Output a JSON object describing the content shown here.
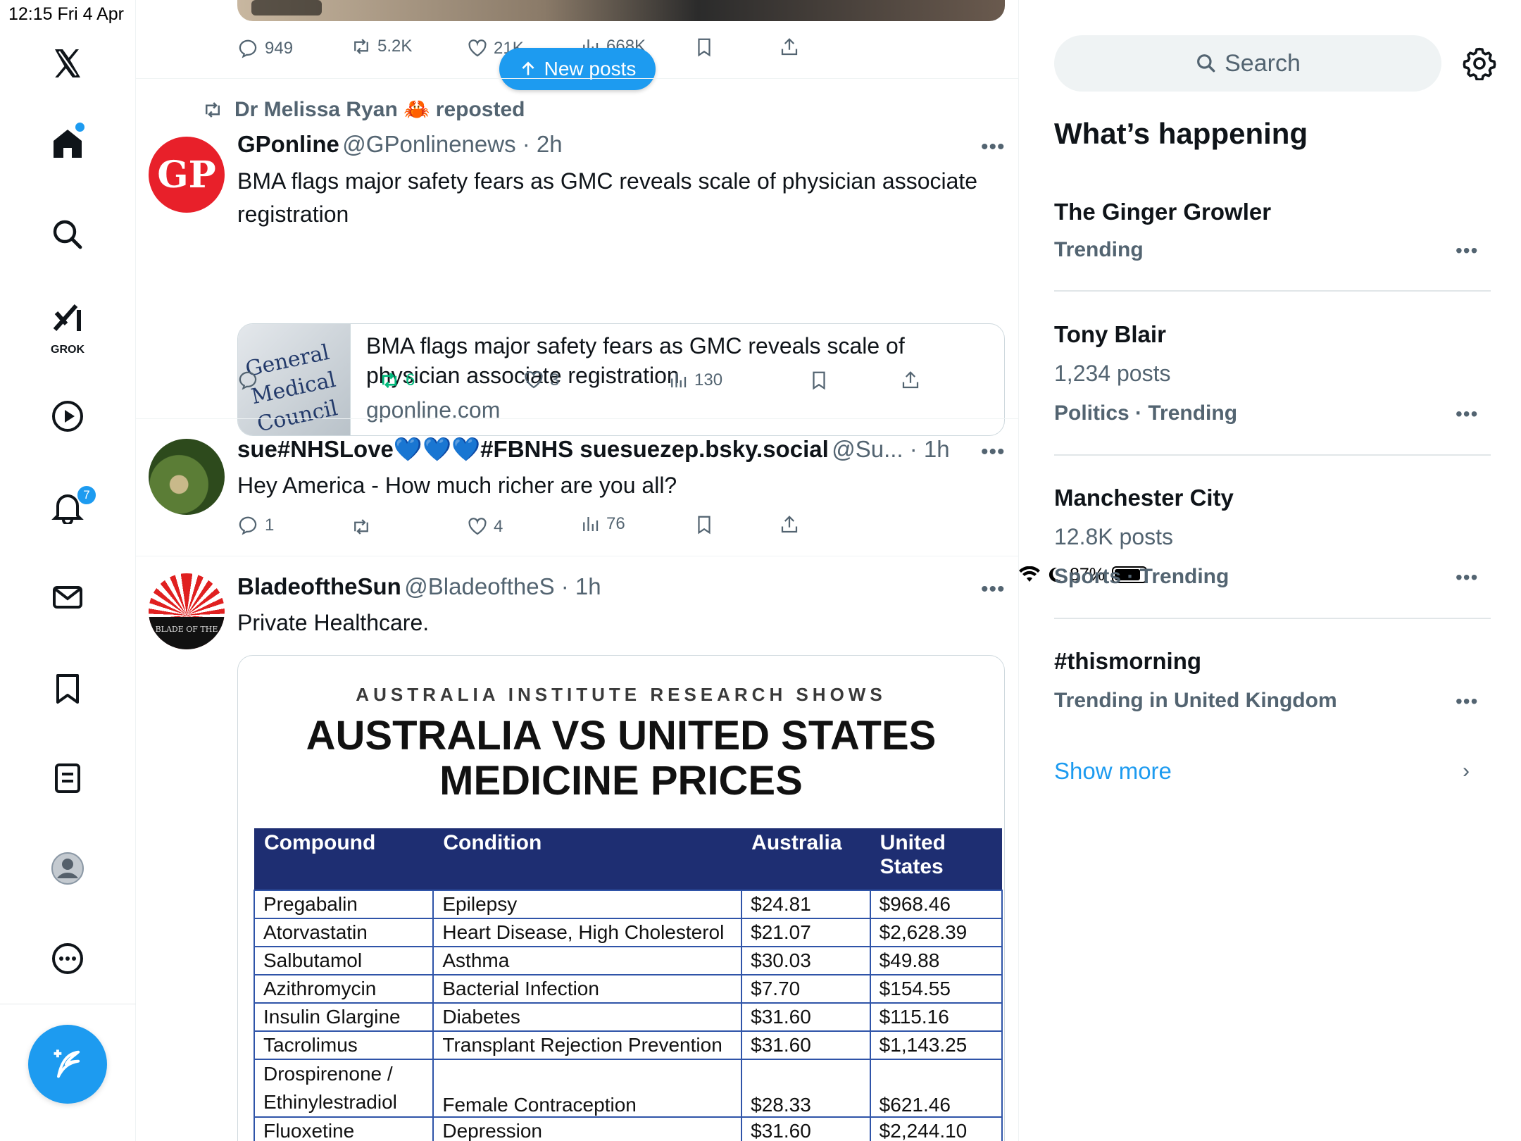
{
  "status_bar": {
    "time_date": "12:15   Fri 4 Apr",
    "battery": "87%",
    "battery_level": 0.87
  },
  "sidebar": {
    "grok_label": "GROK",
    "notifications_count": "7"
  },
  "new_posts": {
    "label": "New posts"
  },
  "previous_tweet": {
    "replies": "949",
    "reposts": "5.2K",
    "likes": "21K",
    "views": "668K"
  },
  "tweets": [
    {
      "repost_note": "Dr Melissa Ryan 🦀 reposted",
      "name": "GPonline",
      "handle": "@GPonlinenews · 2h",
      "avatar_text": "GP",
      "text": "BMA flags major safety fears as GMC reveals scale of physician associate registration",
      "link_card": {
        "thumb_text": "General Medical Council",
        "title": "BMA flags major safety fears as GMC reveals scale of physician associate registration",
        "domain": "gponline.com"
      },
      "replies": "",
      "reposts": "6",
      "likes": "3",
      "views": "130"
    },
    {
      "name": "sue#NHSLove💙💙💙#FBNHS suesuezep.bsky.social",
      "handle": "@Su... · 1h",
      "text": "Hey America - How much richer are you all?",
      "replies": "1",
      "reposts": "",
      "likes": "4",
      "views": "76"
    },
    {
      "name": "BladeoftheSun",
      "handle": "@BladeoftheS · 1h",
      "avatar_text": "BLADE OF THE",
      "text": "Private Healthcare.",
      "media": {
        "subtitle": "AUSTRALIA INSTITUTE RESEARCH SHOWS",
        "title_line1": "AUSTRALIA VS UNITED STATES",
        "title_line2": "MEDICINE PRICES",
        "headers": [
          "Compound",
          "Condition",
          "Australia",
          "United States"
        ],
        "rows": [
          [
            "Pregabalin",
            "Epilepsy",
            "$24.81",
            "$968.46"
          ],
          [
            "Atorvastatin",
            "Heart Disease, High Cholesterol",
            "$21.07",
            "$2,628.39"
          ],
          [
            "Salbutamol",
            "Asthma",
            "$30.03",
            "$49.88"
          ],
          [
            "Azithromycin",
            "Bacterial Infection",
            "$7.70",
            "$154.55"
          ],
          [
            "Insulin Glargine",
            "Diabetes",
            "$31.60",
            "$115.16"
          ],
          [
            "Tacrolimus",
            "Transplant Rejection Prevention",
            "$31.60",
            "$1,143.25"
          ],
          [
            "Drospirenone / Ethinylestradiol",
            "Female Contraception",
            "$28.33",
            "$621.46"
          ],
          [
            "Fluoxetine",
            "Depression",
            "$31.60",
            "$2,244.10"
          ]
        ]
      }
    }
  ],
  "right": {
    "search_placeholder": "Search",
    "title": "What’s happening",
    "trends": [
      {
        "name": "The Ginger Growler",
        "count": "",
        "meta": "Trending"
      },
      {
        "name": "Tony Blair",
        "count": "1,234 posts",
        "meta": "Politics · Trending"
      },
      {
        "name": "Manchester City",
        "count": "12.8K posts",
        "meta": "Sports · Trending"
      },
      {
        "name": "#thismorning",
        "count": "",
        "meta": "Trending in United Kingdom"
      }
    ],
    "show_more": "Show more"
  },
  "colors": {
    "accent": "#1d9bf0",
    "repost_green": "#00ba7c",
    "muted": "#536471"
  }
}
